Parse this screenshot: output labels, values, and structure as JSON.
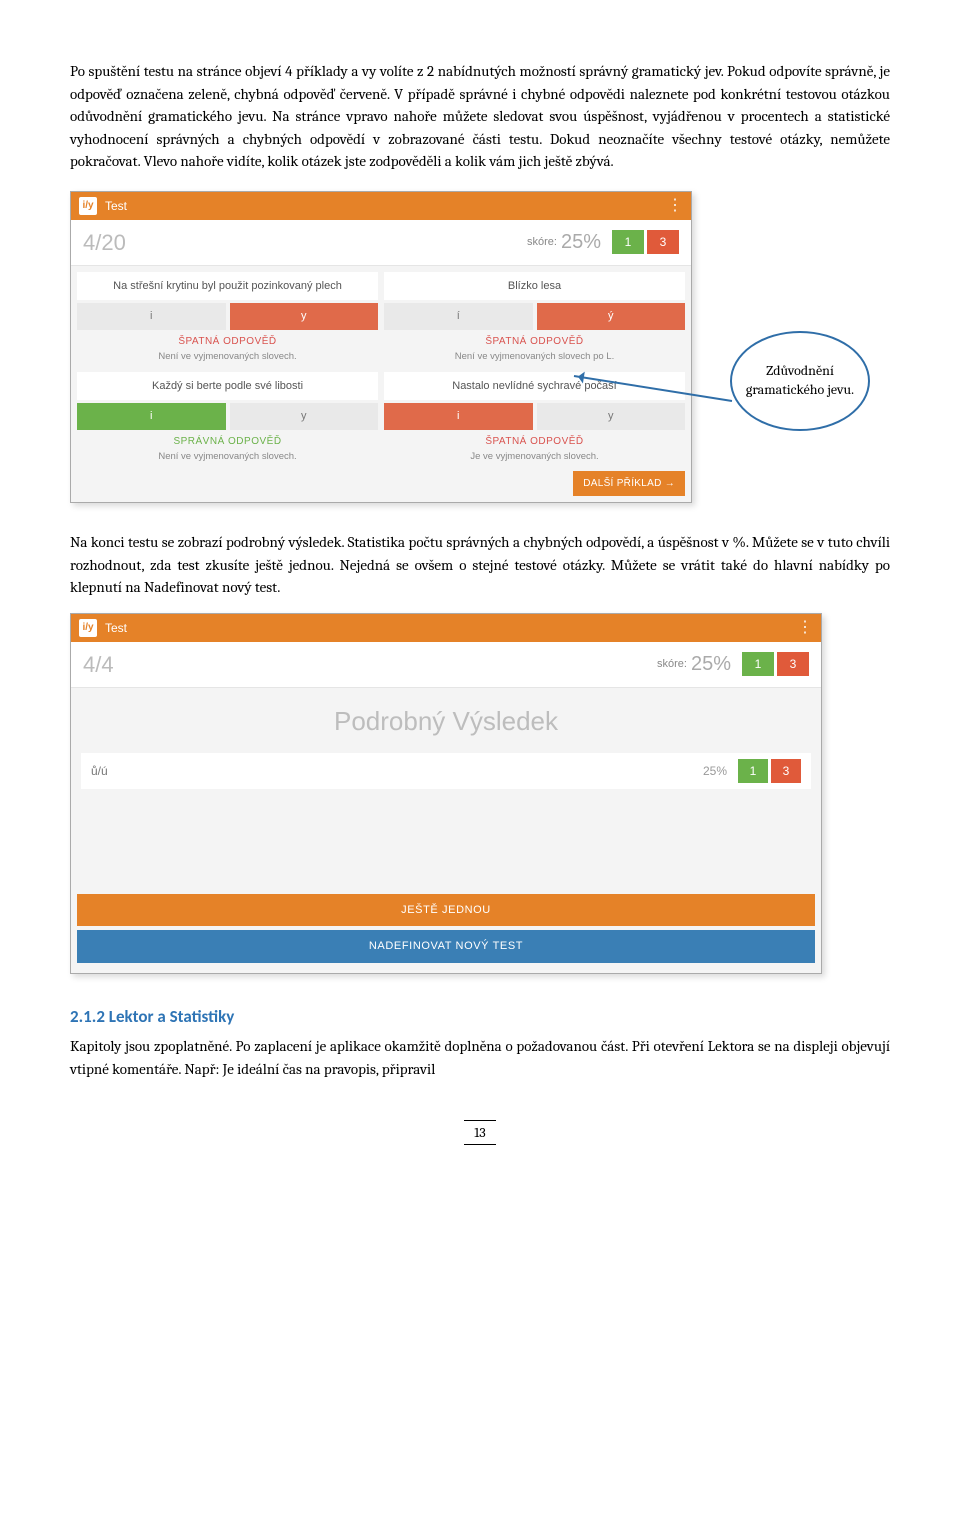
{
  "para1": "Po spuštění testu na stránce objeví 4 příklady a vy volíte z 2 nabídnutých možností správný gramatický jev. Pokud odpovíte správně, je odpověď označena zeleně, chybná odpověď červeně. V případě správné i chybné odpovědi naleznete pod konkrétní testovou otázkou odůvodnění gramatického jevu. Na stránce vpravo nahoře můžete sledovat svou úspěšnost, vyjádřenou v procentech a statistické vyhodnocení správných a chybných odpovědí v zobrazované části testu. Dokud neoznačíte všechny testové otázky, nemůžete pokračovat. Vlevo nahoře vidíte, kolik otázek jste zodpověděli a kolik vám jich ještě zbývá.",
  "callout_text": "Zdůvodnění gramatického jevu.",
  "shot1": {
    "app_title": "Test",
    "progress": "4/20",
    "skore_label": "skóre:",
    "skore_value": "25%",
    "badge_ok": "1",
    "badge_bad": "3",
    "q": [
      {
        "text": "Na střešní krytinu byl použit pozinkovaný plech",
        "a": "i",
        "b": "y",
        "kind": "ŠPATNÁ ODPOVĚĎ",
        "kind_cls": "bad",
        "reason": "Není ve vyjmenovaných slovech."
      },
      {
        "text": "Blízko lesa",
        "a": "í",
        "b": "ý",
        "kind": "ŠPATNÁ ODPOVĚĎ",
        "kind_cls": "bad",
        "reason": "Není ve vyjmenovaných slovech po L."
      },
      {
        "text": "Každý si berte podle své libosti",
        "a": "i",
        "b": "y",
        "kind": "SPRÁVNÁ ODPOVĚĎ",
        "kind_cls": "good",
        "reason": "Není ve vyjmenovaných slovech."
      },
      {
        "text": "Nastalo nevlídné sychravé počasí",
        "a": "i",
        "b": "y",
        "kind": "ŠPATNÁ ODPOVĚĎ",
        "kind_cls": "bad",
        "reason": "Je ve vyjmenovaných slovech."
      }
    ],
    "next_label": "DALŠÍ PŘÍKLAD"
  },
  "para2": "Na konci testu se zobrazí podrobný výsledek. Statistika počtu správných a chybných odpovědí, a úspěšnost v %.  Můžete se v tuto chvíli rozhodnout, zda test zkusíte ještě jednou.  Nejedná se ovšem o stejné testové otázky. Můžete se vrátit také do hlavní nabídky po klepnutí na Nadefinovat nový test.",
  "shot2": {
    "app_title": "Test",
    "progress": "4/4",
    "skore_label": "skóre:",
    "skore_value": "25%",
    "badge_ok": "1",
    "badge_bad": "3",
    "result_title": "Podrobný Výsledek",
    "row_label": "ů/ú",
    "row_pct": "25%",
    "row_ok": "1",
    "row_bad": "3",
    "btn_again": "JEŠTĚ JEDNOU",
    "btn_new": "NADEFINOVAT NOVÝ TEST"
  },
  "heading": "2.1.2   Lektor a Statistiky",
  "para3": "Kapitoly jsou zpoplatněné. Po zaplacení je aplikace okamžitě doplněna o požadovanou část. Při otevření Lektora se na displeji objevují vtipné komentáře. Např: Je ideální čas na pravopis, připravil",
  "page_number": "13"
}
